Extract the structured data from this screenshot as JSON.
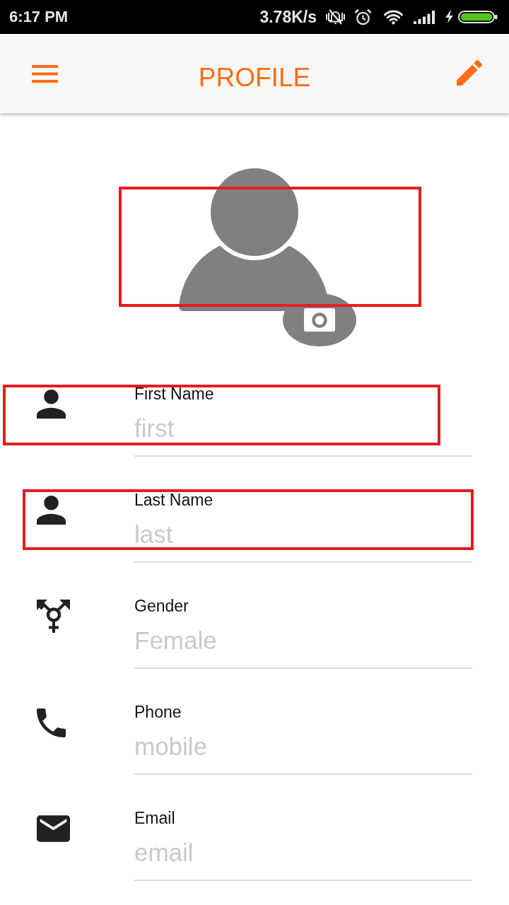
{
  "status_bar": {
    "time": "6:17 PM",
    "network_speed": "3.78K/s"
  },
  "app_bar": {
    "title": "PROFILE"
  },
  "avatar": {
    "highlighted": true
  },
  "fields": [
    {
      "kind": "name",
      "label": "First Name",
      "placeholder": "first",
      "highlighted": true
    },
    {
      "kind": "name",
      "label": "Last Name",
      "placeholder": "last",
      "highlighted": true
    },
    {
      "kind": "gender",
      "label": "Gender",
      "placeholder": "Female",
      "highlighted": false
    },
    {
      "kind": "phone",
      "label": "Phone",
      "placeholder": "mobile",
      "highlighted": false
    },
    {
      "kind": "email",
      "label": "Email",
      "placeholder": "email",
      "highlighted": false
    }
  ]
}
